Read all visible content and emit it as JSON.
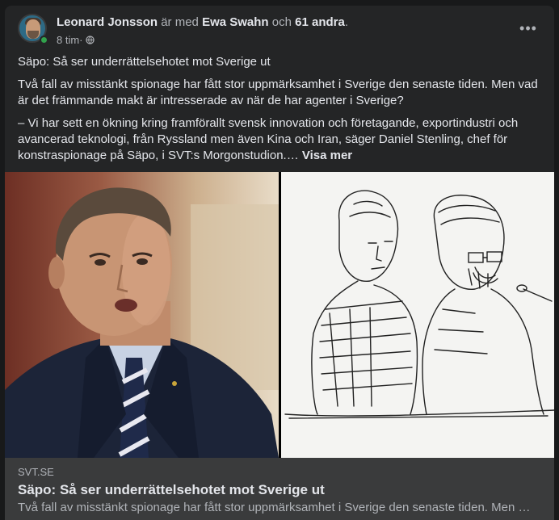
{
  "post": {
    "author": "Leonard Jonsson",
    "with_text": " är med ",
    "tagged": "Ewa Swahn",
    "and_text": " och ",
    "others": "61 andra",
    "period": ".",
    "time": "8 tim",
    "dot": " · ",
    "privacy_icon": "globe-icon",
    "more_icon": "•••",
    "paragraph_1": "Säpo: Så ser underrättelsehotet mot Sverige ut",
    "paragraph_2": "Två fall av misstänkt spionage har fått stor uppmärksamhet i Sverige den senaste tiden. Men vad är det främmande makt är intresserade av när de har agenter i Sverige?",
    "paragraph_3": "– Vi har sett en ökning kring framförallt svensk innovation och företagande, exportindustri och avancerad teknologi, från Ryssland men även Kina och Iran, säger Daniel Stenling, chef för konstraspionage på Säpo, i SVT:s Morgonstudion.… ",
    "see_more": "Visa mer"
  },
  "link_preview": {
    "domain": "SVT.SE",
    "title": "Säpo: Så ser underrättelsehotet mot Sverige ut",
    "description": "Två fall av misstänkt spionage har fått stor uppmärksamhet i Sverige den senaste tiden. Men …"
  },
  "colors": {
    "background": "#18191a",
    "card": "#242526",
    "link_box": "#3a3b3c",
    "online": "#31a24c"
  }
}
